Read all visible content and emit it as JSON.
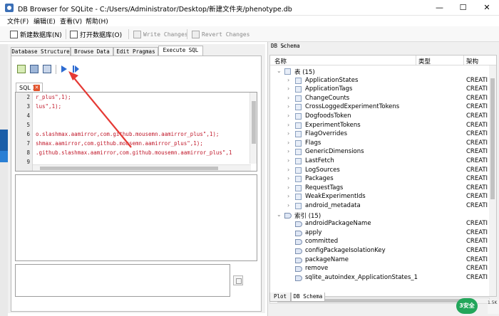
{
  "window": {
    "title": "DB Browser for SQLite - C:/Users/Administrator/Desktop/新建文件夹/phenotype.db",
    "minimize": "—",
    "maximize": "☐",
    "close": "✕"
  },
  "menu": [
    "文件(F)",
    "编辑(E)",
    "查看(V)",
    "帮助(H)"
  ],
  "toolbar": {
    "new_db": "新建数据库(N)",
    "open_db": "打开数据库(O)",
    "write_changes": "Write Changes",
    "revert_changes": "Revert Changes"
  },
  "tabs": [
    "Database Structure",
    "Browse Data",
    "Edit Pragmas",
    "Execute SQL"
  ],
  "active_tab": "Execute SQL",
  "sql_tab": {
    "label": "SQL 1",
    "close": "✕"
  },
  "editor": {
    "line_numbers": [
      "2",
      "3",
      "4",
      "5",
      "6",
      "7",
      "8",
      "9"
    ],
    "lines": [
      "r_plus\",1);",
      "lus\",1);",
      "",
      "",
      "o.slashmax.aamirror,com.github.mousemn.aamirror_plus\",1);",
      "shmax.aamirror,com.github.mousemn.aamirror_plus\",1);",
      ".github.slashmax.aamirror,com.github.mousemn.aamirror_plus\",1",
      ""
    ]
  },
  "schema_panel": {
    "title": "DB Schema",
    "dock_buttons": "▫ ✕",
    "columns": {
      "name": "名称",
      "type": "类型",
      "schema": "架构"
    },
    "tables_group": "表 (15)",
    "tables": [
      "ApplicationStates",
      "ApplicationTags",
      "ChangeCounts",
      "CrossLoggedExperimentTokens",
      "DogfoodsToken",
      "ExperimentTokens",
      "FlagOverrides",
      "Flags",
      "GenericDimensions",
      "LastFetch",
      "LogSources",
      "Packages",
      "RequestTags",
      "WeakExperimentIds",
      "android_metadata"
    ],
    "indices_group": "索引 (15)",
    "indices": [
      "androidPackageName",
      "apply",
      "committed",
      "configPackageIsolationKey",
      "packageName",
      "remove",
      "sqlite_autoindex_ApplicationStates_1"
    ],
    "schema_value": "CREATI"
  },
  "bottom_tabs": [
    "Plot",
    "DB Schema"
  ],
  "active_bottom_tab": "DB Schema",
  "badge": {
    "text": "3安全",
    "side": "1.5K"
  }
}
